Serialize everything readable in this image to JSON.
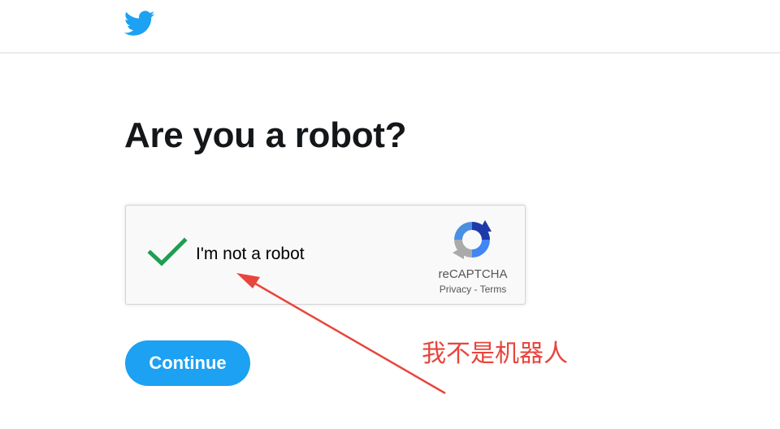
{
  "header": {
    "logo_icon": "twitter-bird-icon",
    "brand_color": "#1da1f2"
  },
  "main": {
    "title": "Are you a robot?"
  },
  "captcha": {
    "checked": true,
    "check_icon": "checkmark-icon",
    "check_color": "#1f9e53",
    "label": "I'm not a robot",
    "logo_icon": "recaptcha-logo-icon",
    "brand_name": "reCAPTCHA",
    "privacy_label": "Privacy",
    "separator": " - ",
    "terms_label": "Terms"
  },
  "actions": {
    "continue_label": "Continue",
    "continue_color": "#1da1f2"
  },
  "annotation": {
    "text": "我不是机器人",
    "color": "#e8453c",
    "arrow_icon": "arrow-icon"
  }
}
